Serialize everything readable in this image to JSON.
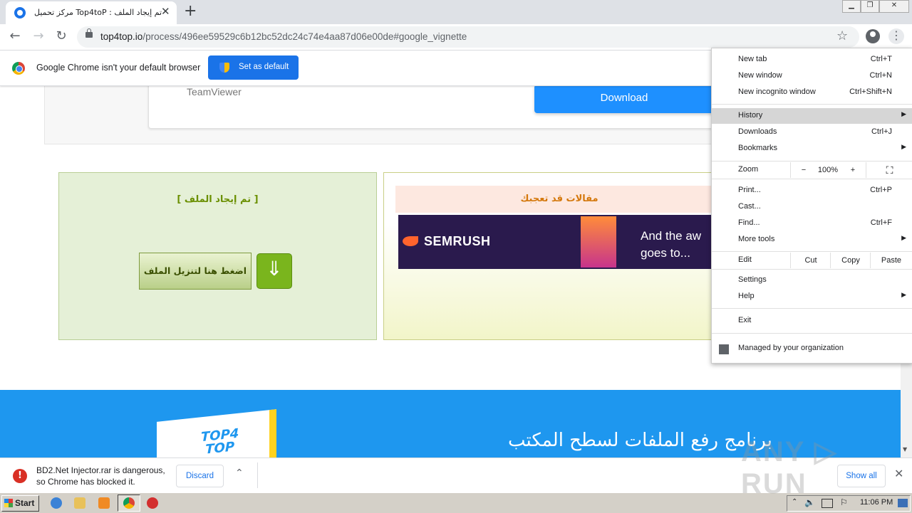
{
  "browser": {
    "tab_title": "مركز تحميل Top4toP : تم إيجاد الملف",
    "url_domain": "top4top.io",
    "url_path": "/process/496ee59529c6b12bc52dc24c74e4aa87d06e00de#google_vignette"
  },
  "infobar": {
    "message": "Google Chrome isn't your default browser",
    "set_default_label": "Set as default"
  },
  "page": {
    "teamviewer_label": "TeamViewer",
    "download_label": "Download",
    "found_title": "[ تم إيجاد الملف ]",
    "click_download_label": "اضغط هنا لتنزيل الملف",
    "articles_title": "مقالات قد تعجبك",
    "ad": {
      "brand": "SEMRUSH",
      "line1": "And the aw",
      "line2": "goes to..."
    },
    "logo_line1": "TOP4",
    "logo_line2": "TOP",
    "footer_title": "برنامج رفع الملفات لسطح المكتب"
  },
  "menu": {
    "new_tab": {
      "label": "New tab",
      "shortcut": "Ctrl+T"
    },
    "new_window": {
      "label": "New window",
      "shortcut": "Ctrl+N"
    },
    "new_incognito": {
      "label": "New incognito window",
      "shortcut": "Ctrl+Shift+N"
    },
    "history": {
      "label": "History"
    },
    "downloads": {
      "label": "Downloads",
      "shortcut": "Ctrl+J"
    },
    "bookmarks": {
      "label": "Bookmarks"
    },
    "zoom": {
      "label": "Zoom",
      "minus": "−",
      "level": "100%",
      "plus": "+"
    },
    "print": {
      "label": "Print...",
      "shortcut": "Ctrl+P"
    },
    "cast": {
      "label": "Cast..."
    },
    "find": {
      "label": "Find...",
      "shortcut": "Ctrl+F"
    },
    "more_tools": {
      "label": "More tools"
    },
    "edit": {
      "label": "Edit",
      "cut": "Cut",
      "copy": "Copy",
      "paste": "Paste"
    },
    "settings": {
      "label": "Settings"
    },
    "help": {
      "label": "Help"
    },
    "exit": {
      "label": "Exit"
    },
    "managed": {
      "label": "Managed by your organization"
    }
  },
  "download_bar": {
    "warning_line1": "BD2.Net Injector.rar is dangerous,",
    "warning_line2": "so Chrome has blocked it.",
    "discard_label": "Discard",
    "show_all_label": "Show all"
  },
  "taskbar": {
    "start_label": "Start",
    "clock": "11:06 PM"
  },
  "watermark": "ANY ▷ RUN"
}
